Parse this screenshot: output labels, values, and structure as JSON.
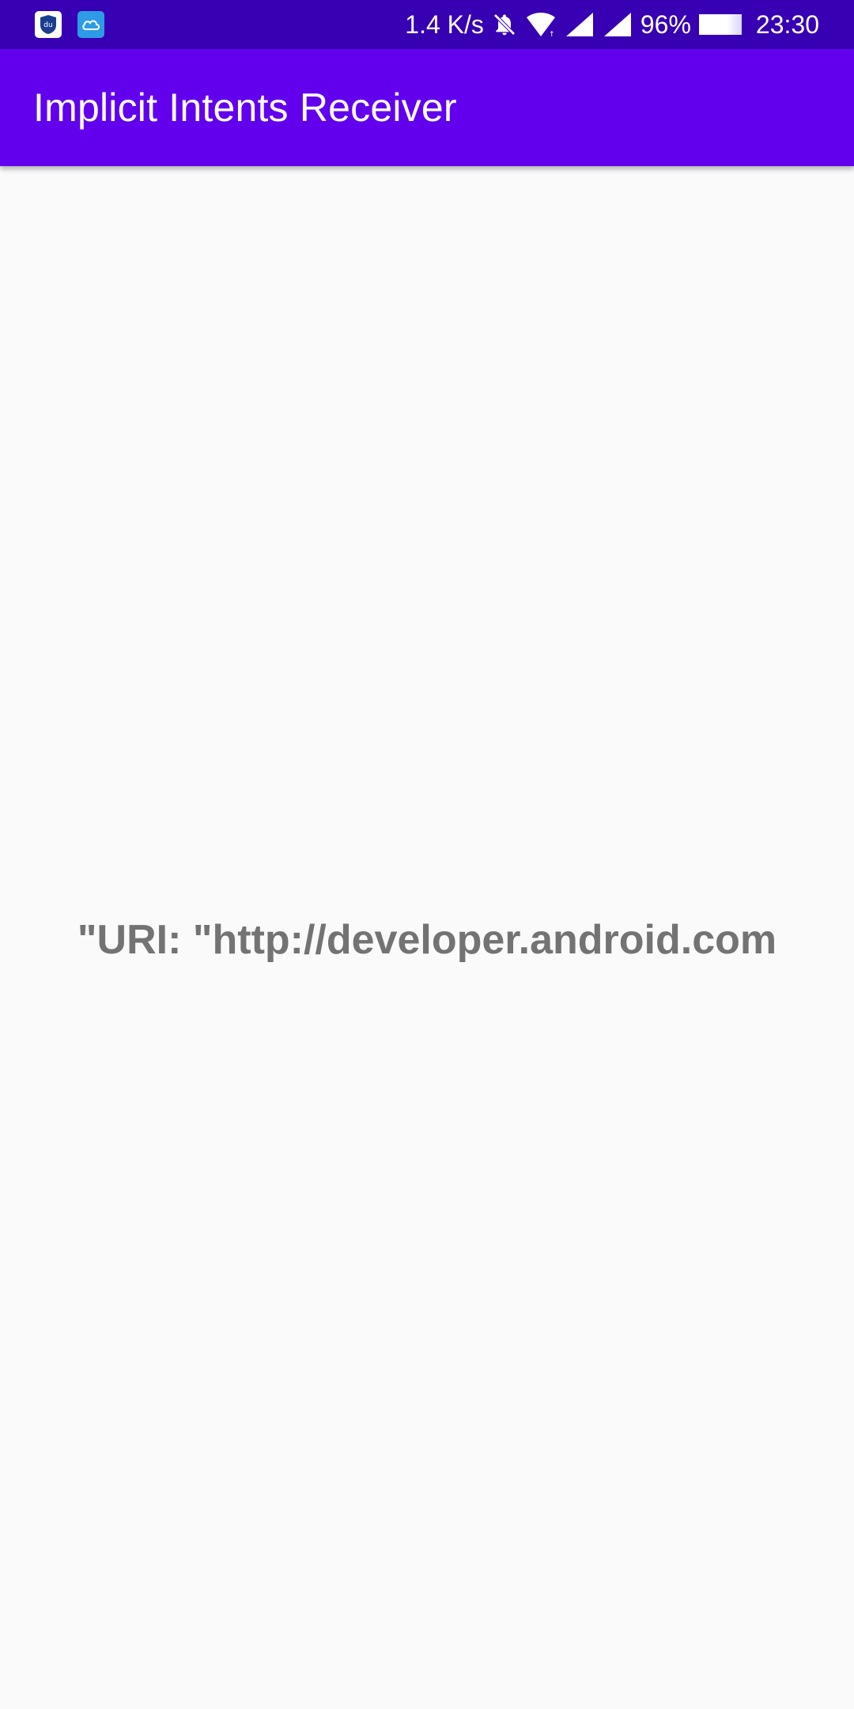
{
  "status_bar": {
    "notification_icons": [
      "app-notification-icon",
      "cloud-icon"
    ],
    "network_speed": "1.4 K/s",
    "icons": [
      "bell-off-icon",
      "wifi-icon",
      "signal-icon",
      "signal-icon",
      "battery-icon"
    ],
    "battery_percent": "96%",
    "time": "23:30"
  },
  "app_bar": {
    "title": "Implicit Intents Receiver"
  },
  "main": {
    "uri_text": "\"URI: \"http://developer.android.com"
  },
  "colors": {
    "status_bar": "#3700b3",
    "app_bar": "#6200ee",
    "background": "#fafafa",
    "text": "#737373"
  }
}
